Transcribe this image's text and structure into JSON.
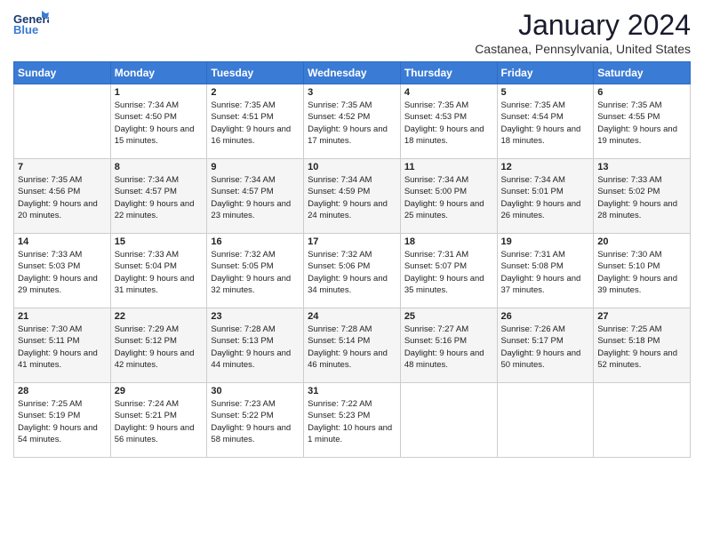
{
  "header": {
    "logo_general": "General",
    "logo_blue": "Blue",
    "month": "January 2024",
    "location": "Castanea, Pennsylvania, United States"
  },
  "days_of_week": [
    "Sunday",
    "Monday",
    "Tuesday",
    "Wednesday",
    "Thursday",
    "Friday",
    "Saturday"
  ],
  "weeks": [
    [
      {
        "day": "",
        "sunrise": "",
        "sunset": "",
        "daylight": ""
      },
      {
        "day": "1",
        "sunrise": "Sunrise: 7:34 AM",
        "sunset": "Sunset: 4:50 PM",
        "daylight": "Daylight: 9 hours and 15 minutes."
      },
      {
        "day": "2",
        "sunrise": "Sunrise: 7:35 AM",
        "sunset": "Sunset: 4:51 PM",
        "daylight": "Daylight: 9 hours and 16 minutes."
      },
      {
        "day": "3",
        "sunrise": "Sunrise: 7:35 AM",
        "sunset": "Sunset: 4:52 PM",
        "daylight": "Daylight: 9 hours and 17 minutes."
      },
      {
        "day": "4",
        "sunrise": "Sunrise: 7:35 AM",
        "sunset": "Sunset: 4:53 PM",
        "daylight": "Daylight: 9 hours and 18 minutes."
      },
      {
        "day": "5",
        "sunrise": "Sunrise: 7:35 AM",
        "sunset": "Sunset: 4:54 PM",
        "daylight": "Daylight: 9 hours and 18 minutes."
      },
      {
        "day": "6",
        "sunrise": "Sunrise: 7:35 AM",
        "sunset": "Sunset: 4:55 PM",
        "daylight": "Daylight: 9 hours and 19 minutes."
      }
    ],
    [
      {
        "day": "7",
        "sunrise": "Sunrise: 7:35 AM",
        "sunset": "Sunset: 4:56 PM",
        "daylight": "Daylight: 9 hours and 20 minutes."
      },
      {
        "day": "8",
        "sunrise": "Sunrise: 7:34 AM",
        "sunset": "Sunset: 4:57 PM",
        "daylight": "Daylight: 9 hours and 22 minutes."
      },
      {
        "day": "9",
        "sunrise": "Sunrise: 7:34 AM",
        "sunset": "Sunset: 4:57 PM",
        "daylight": "Daylight: 9 hours and 23 minutes."
      },
      {
        "day": "10",
        "sunrise": "Sunrise: 7:34 AM",
        "sunset": "Sunset: 4:59 PM",
        "daylight": "Daylight: 9 hours and 24 minutes."
      },
      {
        "day": "11",
        "sunrise": "Sunrise: 7:34 AM",
        "sunset": "Sunset: 5:00 PM",
        "daylight": "Daylight: 9 hours and 25 minutes."
      },
      {
        "day": "12",
        "sunrise": "Sunrise: 7:34 AM",
        "sunset": "Sunset: 5:01 PM",
        "daylight": "Daylight: 9 hours and 26 minutes."
      },
      {
        "day": "13",
        "sunrise": "Sunrise: 7:33 AM",
        "sunset": "Sunset: 5:02 PM",
        "daylight": "Daylight: 9 hours and 28 minutes."
      }
    ],
    [
      {
        "day": "14",
        "sunrise": "Sunrise: 7:33 AM",
        "sunset": "Sunset: 5:03 PM",
        "daylight": "Daylight: 9 hours and 29 minutes."
      },
      {
        "day": "15",
        "sunrise": "Sunrise: 7:33 AM",
        "sunset": "Sunset: 5:04 PM",
        "daylight": "Daylight: 9 hours and 31 minutes."
      },
      {
        "day": "16",
        "sunrise": "Sunrise: 7:32 AM",
        "sunset": "Sunset: 5:05 PM",
        "daylight": "Daylight: 9 hours and 32 minutes."
      },
      {
        "day": "17",
        "sunrise": "Sunrise: 7:32 AM",
        "sunset": "Sunset: 5:06 PM",
        "daylight": "Daylight: 9 hours and 34 minutes."
      },
      {
        "day": "18",
        "sunrise": "Sunrise: 7:31 AM",
        "sunset": "Sunset: 5:07 PM",
        "daylight": "Daylight: 9 hours and 35 minutes."
      },
      {
        "day": "19",
        "sunrise": "Sunrise: 7:31 AM",
        "sunset": "Sunset: 5:08 PM",
        "daylight": "Daylight: 9 hours and 37 minutes."
      },
      {
        "day": "20",
        "sunrise": "Sunrise: 7:30 AM",
        "sunset": "Sunset: 5:10 PM",
        "daylight": "Daylight: 9 hours and 39 minutes."
      }
    ],
    [
      {
        "day": "21",
        "sunrise": "Sunrise: 7:30 AM",
        "sunset": "Sunset: 5:11 PM",
        "daylight": "Daylight: 9 hours and 41 minutes."
      },
      {
        "day": "22",
        "sunrise": "Sunrise: 7:29 AM",
        "sunset": "Sunset: 5:12 PM",
        "daylight": "Daylight: 9 hours and 42 minutes."
      },
      {
        "day": "23",
        "sunrise": "Sunrise: 7:28 AM",
        "sunset": "Sunset: 5:13 PM",
        "daylight": "Daylight: 9 hours and 44 minutes."
      },
      {
        "day": "24",
        "sunrise": "Sunrise: 7:28 AM",
        "sunset": "Sunset: 5:14 PM",
        "daylight": "Daylight: 9 hours and 46 minutes."
      },
      {
        "day": "25",
        "sunrise": "Sunrise: 7:27 AM",
        "sunset": "Sunset: 5:16 PM",
        "daylight": "Daylight: 9 hours and 48 minutes."
      },
      {
        "day": "26",
        "sunrise": "Sunrise: 7:26 AM",
        "sunset": "Sunset: 5:17 PM",
        "daylight": "Daylight: 9 hours and 50 minutes."
      },
      {
        "day": "27",
        "sunrise": "Sunrise: 7:25 AM",
        "sunset": "Sunset: 5:18 PM",
        "daylight": "Daylight: 9 hours and 52 minutes."
      }
    ],
    [
      {
        "day": "28",
        "sunrise": "Sunrise: 7:25 AM",
        "sunset": "Sunset: 5:19 PM",
        "daylight": "Daylight: 9 hours and 54 minutes."
      },
      {
        "day": "29",
        "sunrise": "Sunrise: 7:24 AM",
        "sunset": "Sunset: 5:21 PM",
        "daylight": "Daylight: 9 hours and 56 minutes."
      },
      {
        "day": "30",
        "sunrise": "Sunrise: 7:23 AM",
        "sunset": "Sunset: 5:22 PM",
        "daylight": "Daylight: 9 hours and 58 minutes."
      },
      {
        "day": "31",
        "sunrise": "Sunrise: 7:22 AM",
        "sunset": "Sunset: 5:23 PM",
        "daylight": "Daylight: 10 hours and 1 minute."
      },
      {
        "day": "",
        "sunrise": "",
        "sunset": "",
        "daylight": ""
      },
      {
        "day": "",
        "sunrise": "",
        "sunset": "",
        "daylight": ""
      },
      {
        "day": "",
        "sunrise": "",
        "sunset": "",
        "daylight": ""
      }
    ]
  ]
}
